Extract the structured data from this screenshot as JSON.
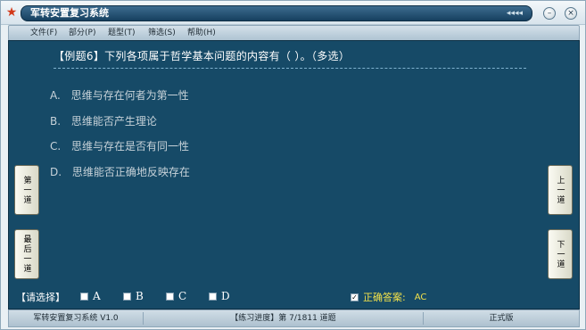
{
  "window": {
    "title": "军转安置复习系统",
    "title_arrows": "◂◂◂◂",
    "app_icon": "★",
    "minimize_glyph": "–",
    "close_glyph": "×"
  },
  "menu": {
    "items": [
      {
        "label": "文件(F)"
      },
      {
        "label": "部分(P)"
      },
      {
        "label": "题型(T)"
      },
      {
        "label": "筛选(S)"
      },
      {
        "label": "帮助(H)"
      }
    ]
  },
  "question": {
    "text": "【例题6】下列各项属于哲学基本问题的内容有（   ）。（多选）",
    "options": [
      {
        "letter": "A.",
        "text": "思维与存在何者为第一性"
      },
      {
        "letter": "B.",
        "text": "思维能否产生理论"
      },
      {
        "letter": "C.",
        "text": "思维与存在是否有同一性"
      },
      {
        "letter": "D.",
        "text": "思维能否正确地反映存在"
      }
    ]
  },
  "nav": {
    "first": "第一道",
    "last": "最后一道",
    "prev": "上一道",
    "next": "下一道"
  },
  "select": {
    "label": "【请选择】",
    "choices": [
      {
        "label": "A",
        "checked": false
      },
      {
        "label": "B",
        "checked": false
      },
      {
        "label": "C",
        "checked": false
      },
      {
        "label": "D",
        "checked": false
      }
    ]
  },
  "answer": {
    "checked": true,
    "check_glyph": "✓",
    "label": "正确答案:",
    "value": "AC"
  },
  "status": {
    "app_version": "军转安置复习系统 V1.0",
    "progress": "【练习进度】第 7/1811 道题",
    "mode": "正式版"
  },
  "colors": {
    "content_bg": "#164a67",
    "answer_yellow": "#f3e24a"
  }
}
